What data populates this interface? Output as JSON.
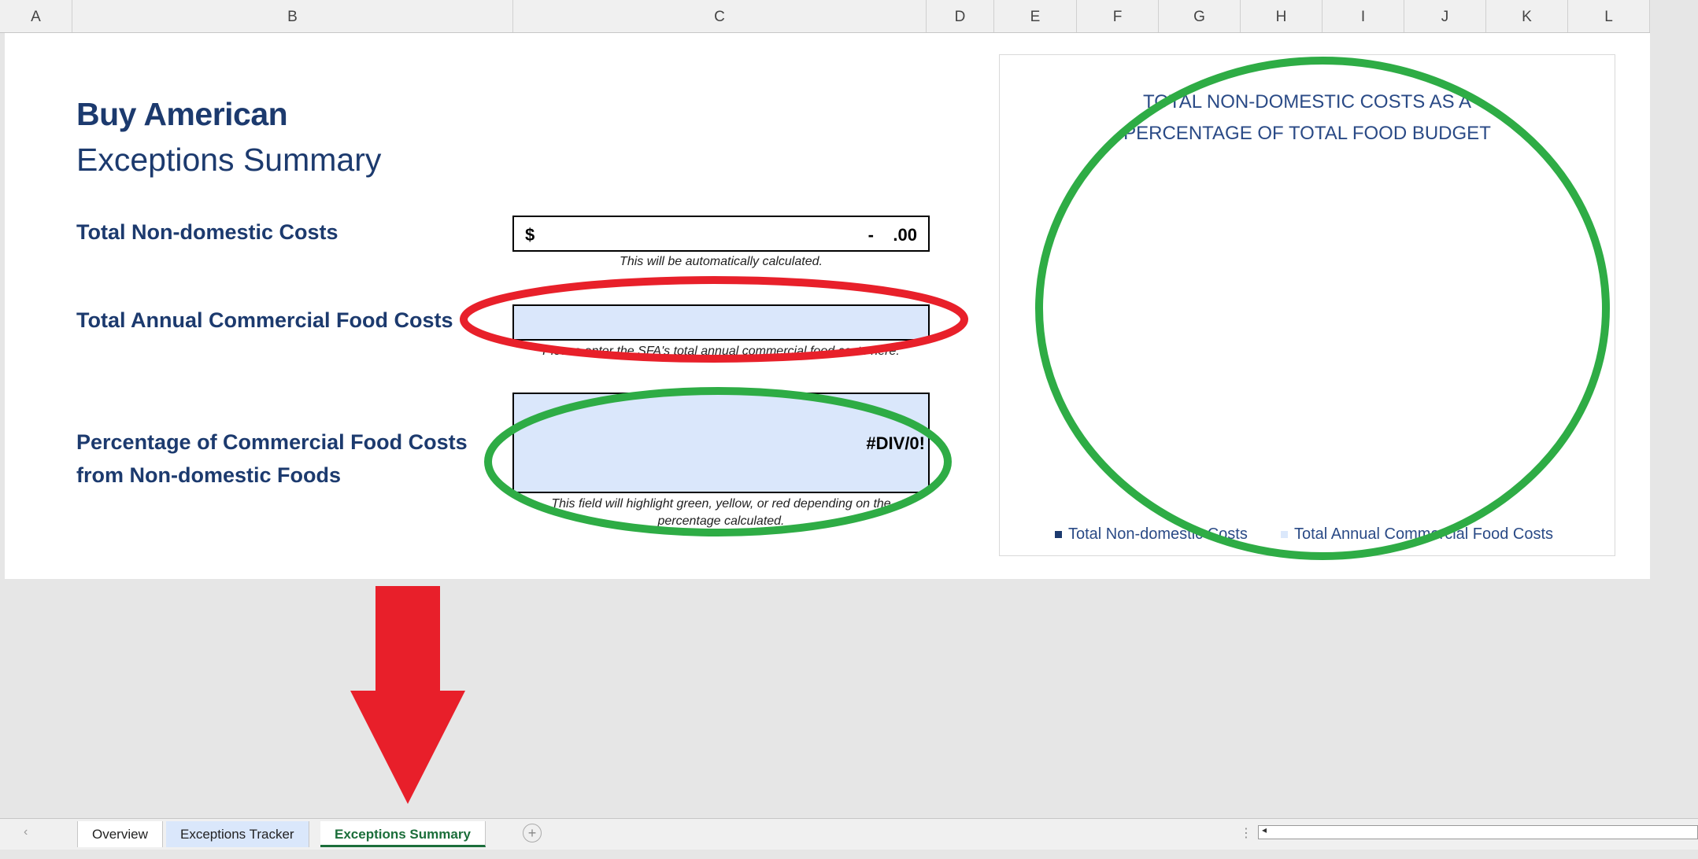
{
  "columns": [
    "A",
    "B",
    "C",
    "D",
    "E",
    "F",
    "G",
    "H",
    "I",
    "J",
    "K",
    "L"
  ],
  "title": {
    "main": "Buy American",
    "sub": "Exceptions Summary"
  },
  "rows": {
    "non_domestic": {
      "label": "Total Non-domestic Costs",
      "currency": "$",
      "value": "-    .00",
      "hint": "This will be automatically calculated."
    },
    "annual_food": {
      "label": "Total Annual Commercial Food Costs",
      "value": "",
      "hint": "Please enter the SFA's total annual commercial food costs here."
    },
    "percentage": {
      "label_line1": "Percentage of Commercial Food Costs",
      "label_line2": "from Non-domestic Foods",
      "value": "#DIV/0!",
      "hint_line1": "This field will highlight green, yellow, or red depending on the",
      "hint_line2": "percentage calculated."
    }
  },
  "chart": {
    "title_line1": "TOTAL NON-DOMESTIC COSTS AS A",
    "title_line2": "PERCENTAGE OF TOTAL FOOD BUDGET",
    "legend": [
      {
        "label": "Total Non-domestic Costs",
        "color": "#1c3a6e"
      },
      {
        "label": "Total Annual Commercial Food Costs",
        "color": "#dbe8fb"
      }
    ]
  },
  "tabs": [
    {
      "label": "Overview"
    },
    {
      "label": "Exceptions Tracker"
    },
    {
      "label": "Exceptions Summary"
    }
  ],
  "colors": {
    "input_fill": "#dae7fb",
    "annotation_red": "#e8202a",
    "annotation_green": "#2eac45",
    "heading": "#1c3a6e"
  }
}
